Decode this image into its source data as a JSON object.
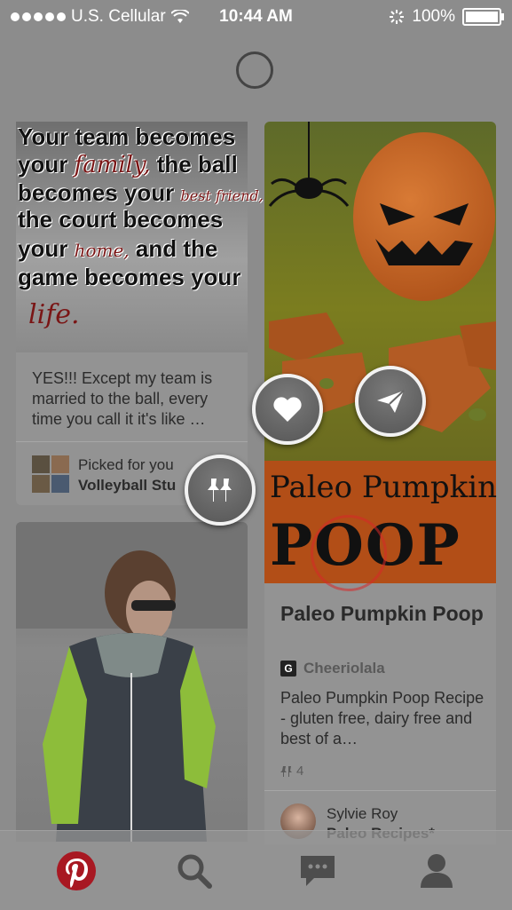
{
  "status_bar": {
    "carrier": "U.S. Cellular",
    "time": "10:44 AM",
    "battery": "100%"
  },
  "pins": {
    "volleyball": {
      "image_text": {
        "line1": "Your team becomes",
        "line2_a": "your",
        "line2_script": "family,",
        "line2_b": "the ball",
        "line3_a": "becomes your",
        "line3_script": "best friend,",
        "line4": "the court becomes",
        "line5_a": "your",
        "line5_script": "home,",
        "line5_b": "and the",
        "line6": "game becomes your",
        "line7_script": "life."
      },
      "description": "YES!!! Except my team is married to the ball, every time you call it it's like …",
      "picked_label": "Picked for you",
      "board_name": "Volleyball Stu"
    },
    "paleo": {
      "image_text_line1": "Paleo Pumpkin",
      "image_text_line2": "POOP",
      "title": "Paleo Pumpkin Poop",
      "source_badge": "G",
      "source": "Cheeriolala",
      "description": "Paleo Pumpkin Poop Recipe - gluten free, dairy free and best of a…",
      "repin_count": "4",
      "pinner_name": "Sylvie Roy",
      "board_name": "Paleo Recipes*"
    }
  },
  "actions": {
    "like": "heart-icon",
    "send": "send-icon",
    "pin_it": "pin-icon"
  },
  "tab_bar": {
    "items": [
      "home",
      "search",
      "messages",
      "profile"
    ],
    "accent_color": "#a81822"
  }
}
